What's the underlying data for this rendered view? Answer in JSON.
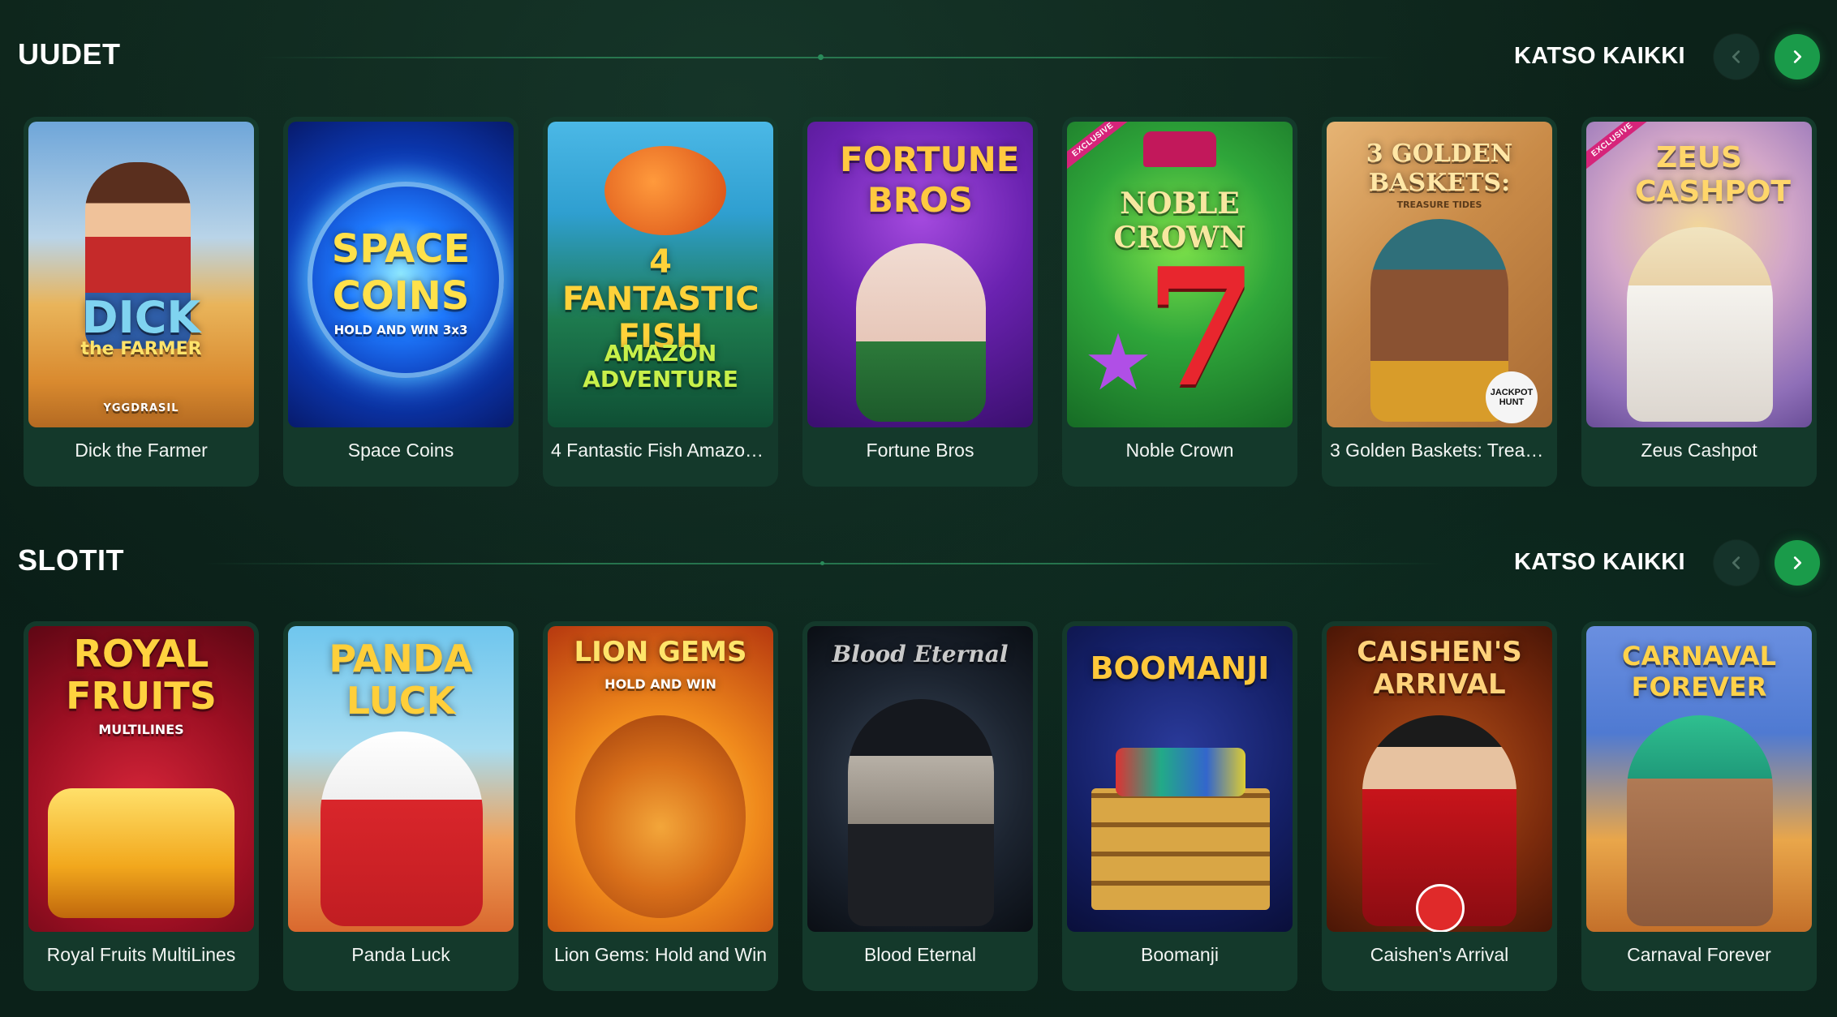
{
  "sections": [
    {
      "title": "UUDET",
      "see_all": "KATSO KAIKKI",
      "games": [
        {
          "name": "Dick the Farmer",
          "art_title": "DICK",
          "art_sub": "the FARMER",
          "provider": "YGGDRASIL",
          "exclusive": false
        },
        {
          "name": "Space Coins",
          "art_title": "SPACE COINS",
          "art_sub": "HOLD AND WIN 3x3",
          "exclusive": false
        },
        {
          "name": "4 Fantastic Fish Amazon ...",
          "art_title": "4 FANTASTIC FISH",
          "art_sub": "AMAZON ADVENTURE",
          "exclusive": false
        },
        {
          "name": "Fortune Bros",
          "art_title": "FORTUNE BROS",
          "exclusive": false
        },
        {
          "name": "Noble Crown",
          "art_title": "NOBLE CROWN",
          "exclusive": true,
          "badge": "EXCLUSIVE"
        },
        {
          "name": "3 Golden Baskets: Treas...",
          "art_title": "3 GOLDEN BASKETS:",
          "art_sub": "TREASURE TIDES",
          "logo": "JACKPOT HUNT",
          "exclusive": false
        },
        {
          "name": "Zeus Cashpot",
          "art_title": "ZEUS CASHPOT",
          "exclusive": true,
          "badge": "EXCLUSIVE"
        }
      ]
    },
    {
      "title": "SLOTIT",
      "see_all": "KATSO KAIKKI",
      "games": [
        {
          "name": "Royal Fruits MultiLines",
          "art_title": "ROYAL FRUITS",
          "art_sub": "MULTILINES"
        },
        {
          "name": "Panda Luck",
          "art_title": "PANDA LUCK"
        },
        {
          "name": "Lion Gems: Hold and Win",
          "art_title": "LION GEMS",
          "art_sub": "HOLD AND WIN"
        },
        {
          "name": "Blood Eternal",
          "art_title": "Blood Eternal"
        },
        {
          "name": "Boomanji",
          "art_title": "BOOMANJI"
        },
        {
          "name": "Caishen's Arrival",
          "art_title": "CAISHEN'S ARRIVAL"
        },
        {
          "name": "Carnaval Forever",
          "art_title": "CARNAVAL FOREVER"
        }
      ]
    }
  ],
  "icons": {
    "prev": "chevron-left-icon",
    "next": "chevron-right-icon"
  },
  "colors": {
    "background": "#0b2119",
    "card": "#14392b",
    "accent": "#1a9b4a",
    "nav_inactive": "#15332a",
    "badge": "#d6247a"
  }
}
